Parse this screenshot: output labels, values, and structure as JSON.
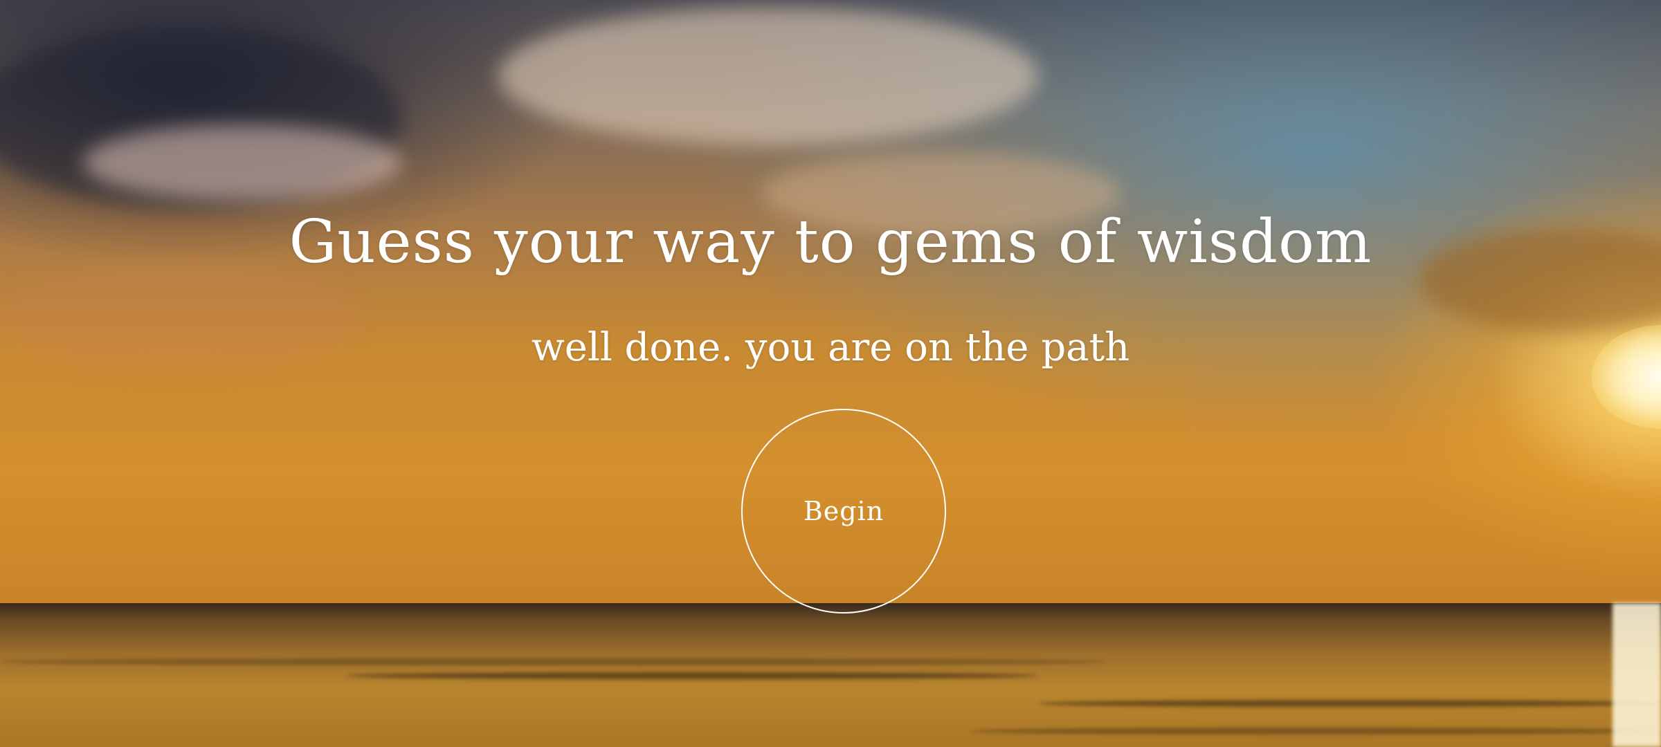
{
  "hero": {
    "title": "Guess your way to gems of wisdom",
    "subtitle": "well done. you are on the path",
    "begin_label": "Begin"
  },
  "colors": {
    "text": "#ffffff",
    "button_border": "#ffffff"
  }
}
